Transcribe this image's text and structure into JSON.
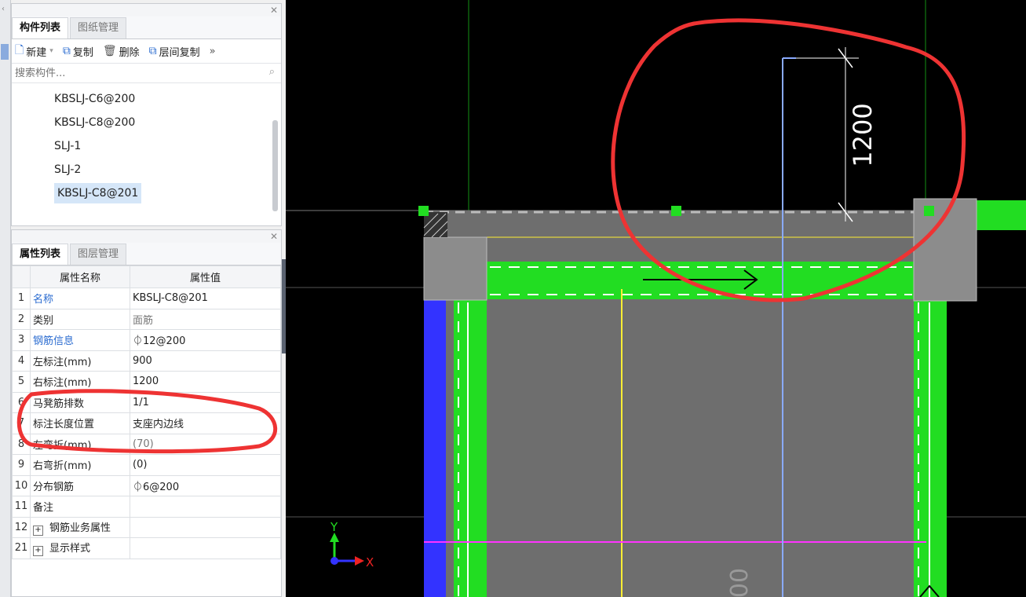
{
  "components_panel": {
    "tabs": [
      "构件列表",
      "图纸管理"
    ],
    "toolbar": {
      "new_label": "新建",
      "copy_label": "复制",
      "delete_label": "删除",
      "floor_copy_label": "层间复制",
      "more_label": "»"
    },
    "search_placeholder": "搜索构件...",
    "items": [
      "KBSLJ-C6@200",
      "KBSLJ-C8@200",
      "SLJ-1",
      "SLJ-2",
      "KBSLJ-C8@201"
    ],
    "selected_index": 4
  },
  "properties_panel": {
    "tabs": [
      "属性列表",
      "图层管理"
    ],
    "headers": {
      "name": "属性名称",
      "value": "属性值"
    },
    "rows": [
      {
        "num": "1",
        "name": "名称",
        "value": "KBSLJ-C8@201"
      },
      {
        "num": "2",
        "name": "类别",
        "value": "面筋"
      },
      {
        "num": "3",
        "name": "钢筋信息",
        "value": "⏀12@200"
      },
      {
        "num": "4",
        "name": "左标注(mm)",
        "value": "900"
      },
      {
        "num": "5",
        "name": "右标注(mm)",
        "value": "1200"
      },
      {
        "num": "6",
        "name": "马凳筋排数",
        "value": "1/1"
      },
      {
        "num": "7",
        "name": "标注长度位置",
        "value": "支座内边线"
      },
      {
        "num": "8",
        "name": "左弯折(mm)",
        "value": "(70)"
      },
      {
        "num": "9",
        "name": "右弯折(mm)",
        "value": "(0)"
      },
      {
        "num": "10",
        "name": "分布钢筋",
        "value": "⏀6@200"
      },
      {
        "num": "11",
        "name": "备注",
        "value": ""
      },
      {
        "num": "12",
        "name": "钢筋业务属性",
        "value": ""
      },
      {
        "num": "21",
        "name": "显示样式",
        "value": ""
      }
    ]
  },
  "canvas": {
    "dimension_label": "1200",
    "partial_label": "00",
    "axis_y": "Y",
    "axis_x": "X"
  },
  "colors": {
    "rebar_green": "#22dd22",
    "slab_grey": "#6e6e6e",
    "support_grey": "#8c8c8c",
    "annotation_red": "#ee3333",
    "axis_blue": "#8aaaff",
    "magenta_line": "#ff33ff",
    "yellow_line": "#ffee33",
    "edge_blue": "#3333ff"
  }
}
